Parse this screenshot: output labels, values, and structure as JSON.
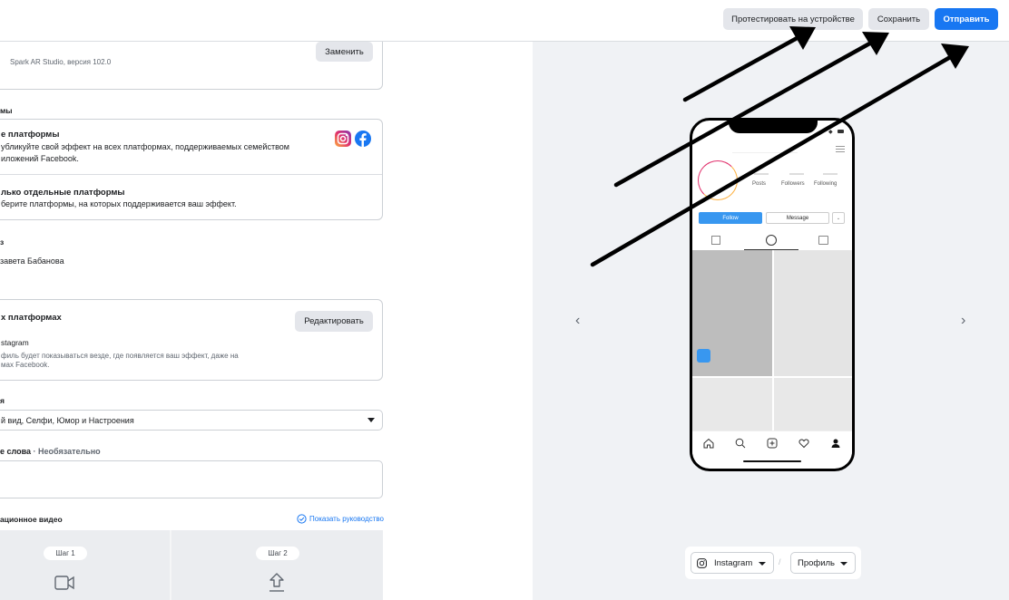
{
  "topbar": {
    "test_label": "Протестировать на устройстве",
    "save_label": "Сохранить",
    "send_label": "Отправить"
  },
  "file_card": {
    "version": "Spark AR Studio, версия 102.0",
    "replace_label": "Заменить"
  },
  "platforms": {
    "section_label": "мы",
    "all": {
      "title": "е платформы",
      "desc_line1": "убликуйте свой эффект на всех платформах, поддерживаемых семейством",
      "desc_line2": "иложений Facebook."
    },
    "specific": {
      "title": "лько отдельные платформы",
      "desc": "берите платформы, на которых поддерживается ваш эффект."
    },
    "icons": [
      "instagram-icon",
      "facebook-icon"
    ]
  },
  "owner": {
    "section_label": "з",
    "name": "завета Бабанова"
  },
  "display": {
    "title": "х платформах",
    "edit_label": "Редактировать",
    "platform": "stagram",
    "note_line1": "филь будет показываться везде, где появляется ваш эффект, даже на",
    "note_line2": "мах Facebook."
  },
  "categories": {
    "section_label": "я",
    "value": "й вид, Селфи, Юмор и Настроения"
  },
  "keywords": {
    "label": "е слова",
    "optional": " · Необязательно"
  },
  "video": {
    "label": "ационное видео",
    "guide_link": "Показать руководство",
    "step1": "Шаг 1",
    "step2": "Шаг 2"
  },
  "preview": {
    "stats": [
      "Posts",
      "Followers",
      "Following"
    ],
    "follow": "Follow",
    "message": "Message"
  },
  "bottom_bar": {
    "platform": "Instagram",
    "mode": "Профиль"
  },
  "colors": {
    "primary": "#1877f2",
    "button_bg": "#e4e6eb",
    "preview_bg": "#f0f2f5"
  }
}
